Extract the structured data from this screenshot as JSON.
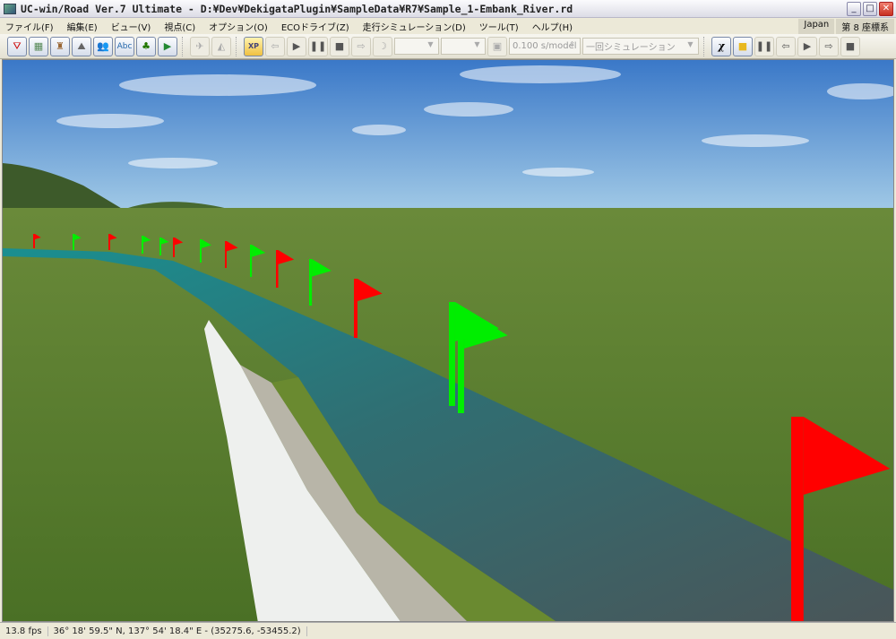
{
  "window": {
    "title": "UC-win/Road Ver.7 Ultimate - D:¥Dev¥DekigataPlugin¥SampleData¥R7¥Sample_1-Embank_River.rd"
  },
  "menu": [
    "ファイル(F)",
    "編集(E)",
    "ビュー(V)",
    "視点(C)",
    "オプション(O)",
    "ECOドライブ(Z)",
    "走行シミュレーション(D)",
    "ツール(T)",
    "ヘルプ(H)"
  ],
  "menu_right": {
    "region": "Japan",
    "coord_system": "第 8 座標系"
  },
  "toolbar": {
    "interval": "0.100 s/model",
    "sim_mode": "一回シミュレーション",
    "xp_label": "XP",
    "text_label": "Abc",
    "chi_label": "χ"
  },
  "status": {
    "fps": "13.8 fps",
    "coords": "36°  18' 59.5\" N, 137°  54' 18.4\" E  -  (35275.6, -53455.2)"
  },
  "colors": {
    "flag_red": "#ff0000",
    "flag_green": "#00ee00",
    "road_teal": "#1a8a8a",
    "grass": "#5a7a2a"
  }
}
